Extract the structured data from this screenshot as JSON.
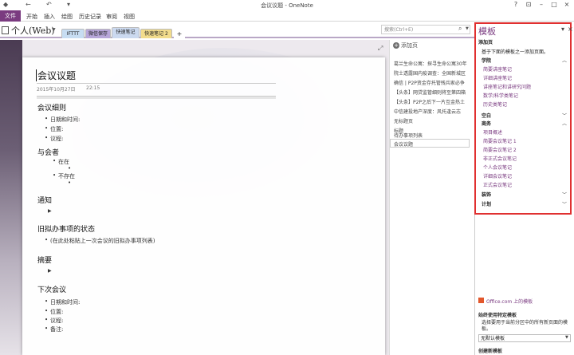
{
  "window": {
    "title": "会议议题 - OneNote",
    "quick_access": {
      "back_icon": "←",
      "undo_icon": "↶",
      "redo_icon": "▾"
    },
    "controls": [
      "?",
      "⊡",
      "–",
      "□",
      "×"
    ]
  },
  "ribbon": {
    "file_label": "文件",
    "tabs": [
      "开始",
      "插入",
      "绘图",
      "历史记录",
      "审阅",
      "视图"
    ]
  },
  "notebook": {
    "name": "个人(Web)",
    "sections": [
      {
        "label": "IFTTT",
        "color": "#c7ddf2"
      },
      {
        "label": "微信保存",
        "color": "#b7a6d9"
      },
      {
        "label": "快速笔记",
        "color": "#cbd9ef"
      },
      {
        "label": "快速笔记 2",
        "color": "#f2dc8c"
      }
    ],
    "add_section": "+"
  },
  "search": {
    "placeholder": "搜索(Ctrl+E)"
  },
  "note": {
    "title": "会议议题",
    "date": "2015年10月27日",
    "time": "22:15",
    "sections": [
      {
        "heading": "会议细则",
        "items": [
          "日期和时间:",
          "位置:",
          "议程:"
        ]
      },
      {
        "heading": "与会者",
        "items": [
          "在在",
          "不存在"
        ]
      },
      {
        "heading": "通知"
      },
      {
        "heading": "旧拟办事项的状态",
        "items": [
          "(在此处粘贴上一次会议的旧拟办事项列表)"
        ]
      },
      {
        "heading": "摘要"
      },
      {
        "heading": "下次会议",
        "items": [
          "日期和时间:",
          "位置:",
          "议程:",
          "备注:"
        ]
      }
    ]
  },
  "page_list": {
    "add_label": "添加页",
    "pages": [
      "葛兰生命公寓：探寻生命公寓30年",
      "院士透露国内疫调查：全国新城区",
      "确信 | P2P资金存托管残兵家必争",
      "【头条】网贷监管细则将至第四箱",
      "【头条】P2P之后下一片互金热土",
      "中信建投地产深度：风托逢云志",
      "无标题页",
      "标题",
      "待办事项列表",
      "会议议题"
    ]
  },
  "templates_pane": {
    "title": "模板",
    "add_page_label": "添加页",
    "instruction": "基于下面的模板之一添加页面。",
    "categories": [
      {
        "name": "学院",
        "items": [
          "简要讲座笔记",
          "详细讲座笔记",
          "讲座笔记和讲研究问题",
          "数学/科学类笔记",
          "历史类笔记"
        ]
      },
      {
        "name": "空白",
        "items": []
      },
      {
        "name": "商务",
        "items": [
          "项目概述",
          "简要会议笔记 1",
          "简要会议笔记 2",
          "非正式会议笔记",
          "个人会议笔记",
          "详细会议笔记",
          "正式会议笔记"
        ]
      },
      {
        "name": "装饰",
        "items": []
      },
      {
        "name": "计划",
        "items": []
      }
    ],
    "office_link": "Office.com 上的模板",
    "always_use_heading": "始终使用特定模板",
    "always_use_desc": "选择要用于当前分区中的所有新页面的模板。",
    "select_value": "无默认模板",
    "create_heading": "创建新模板"
  }
}
